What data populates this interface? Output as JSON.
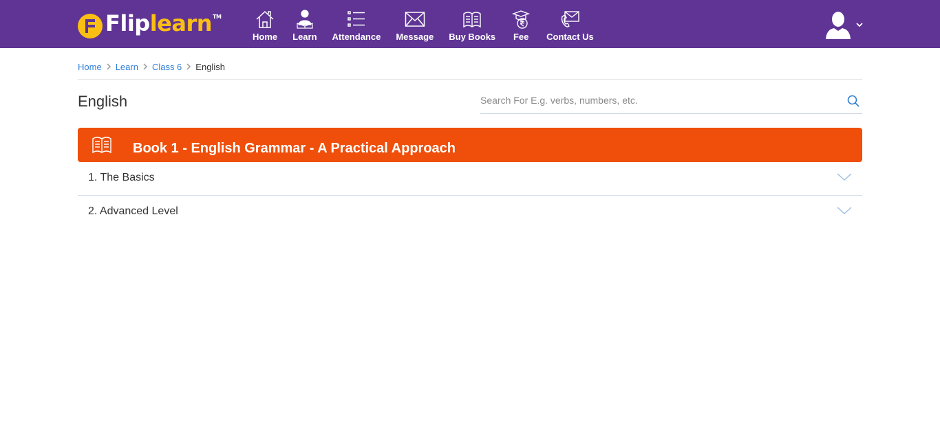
{
  "brand": {
    "name_part1": "Flip",
    "name_part2": "learn",
    "tm": "TM"
  },
  "nav": [
    {
      "label": "Home",
      "icon": "home-icon"
    },
    {
      "label": "Learn",
      "icon": "learn-icon"
    },
    {
      "label": "Attendance",
      "icon": "attendance-icon"
    },
    {
      "label": "Message",
      "icon": "message-icon"
    },
    {
      "label": "Buy Books",
      "icon": "buy-books-icon"
    },
    {
      "label": "Fee",
      "icon": "fee-icon"
    },
    {
      "label": "Contact Us",
      "icon": "contact-us-icon"
    }
  ],
  "breadcrumb": {
    "items": [
      "Home",
      "Learn",
      "Class 6"
    ],
    "current": "English"
  },
  "page": {
    "title": "English"
  },
  "search": {
    "placeholder": "Search For E.g. verbs, numbers, etc."
  },
  "book": {
    "title": "Book 1 - English Grammar - A Practical Approach"
  },
  "chapters": [
    {
      "label": "1. The Basics"
    },
    {
      "label": "2. Advanced Level"
    }
  ],
  "colors": {
    "topbar": "#5f3495",
    "accent_yellow": "#fbbf14",
    "book_bar": "#ef4f0b",
    "link": "#2f7fd6"
  }
}
